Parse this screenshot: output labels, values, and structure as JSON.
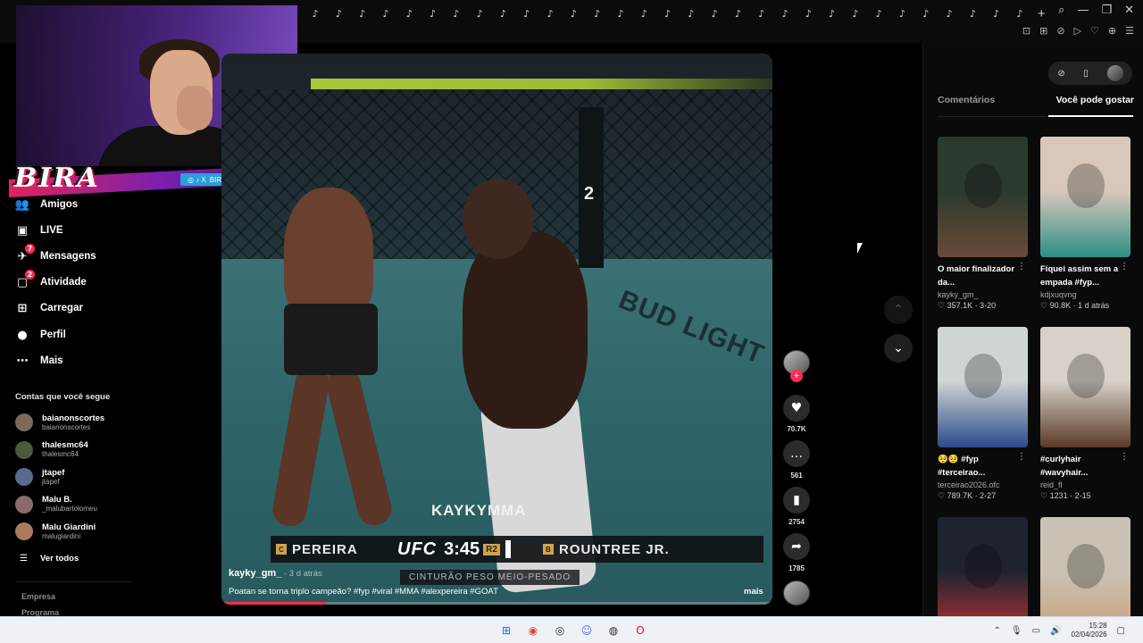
{
  "browser": {
    "tab_glyph": "♪",
    "tab_count": 31,
    "new_tab": "+",
    "window_controls": [
      "⌕",
      "—",
      "❐",
      "✕"
    ],
    "toolbar_icons": [
      "⊡",
      "⊞",
      "⊘",
      "▷",
      "♡",
      "⊕",
      "☰"
    ]
  },
  "stream_overlay": {
    "logo_text": "BIRA",
    "social_handle": "BIROPJL",
    "social_icons": "◎ ♪ X"
  },
  "sidebar": {
    "items": [
      {
        "label": "Amigos",
        "icon": "friends-icon",
        "glyph": "👥",
        "badge": ""
      },
      {
        "label": "LIVE",
        "icon": "live-icon",
        "glyph": "▣",
        "badge": ""
      },
      {
        "label": "Mensagens",
        "icon": "messages-icon",
        "glyph": "✈",
        "badge": "7"
      },
      {
        "label": "Atividade",
        "icon": "activity-icon",
        "glyph": "▢",
        "badge": "2"
      },
      {
        "label": "Carregar",
        "icon": "upload-icon",
        "glyph": "⊞",
        "badge": ""
      },
      {
        "label": "Perfil",
        "icon": "profile-icon",
        "glyph": "●",
        "badge": ""
      },
      {
        "label": "Mais",
        "icon": "more-icon",
        "glyph": "⋯",
        "badge": ""
      }
    ],
    "following_title": "Contas que você segue",
    "following": [
      {
        "name": "baianonscortes",
        "handle": "baianonscortes"
      },
      {
        "name": "thalesmc64",
        "handle": "thalesmc64"
      },
      {
        "name": "jtapef",
        "handle": "jtapef"
      },
      {
        "name": "Malu B.",
        "handle": "_malubartolomeu"
      },
      {
        "name": "Malu Giardini",
        "handle": "malugiardini"
      }
    ],
    "see_all": "Ver todos",
    "footer": [
      "Empresa",
      "Programa"
    ]
  },
  "video": {
    "watermark": "KAYKYMMA",
    "floor_ad": "BUD LIGHT",
    "post_number": "2",
    "scoreboard": {
      "red_corner": "C",
      "red_name": "PEREIRA",
      "brand": "UFC",
      "clock": "3:45",
      "round": "R2",
      "blue_corner": "B",
      "blue_name": "ROUNTREE JR."
    },
    "subtitle": "CINTURÃO PESO MEIO-PESADO",
    "author": "kayky_gm_",
    "time_ago": " · 3 d atrás",
    "description": "Poatan se torna triplo campeão? #fyp #viral #MMA #alexpereira #GOAT",
    "more": "mais",
    "progress": 0.19
  },
  "actions": {
    "follow_plus": "+",
    "likes": "70.7K",
    "comments": "561",
    "saves": "2754",
    "shares": "1785",
    "like_glyph": "♥",
    "comment_glyph": "…",
    "save_glyph": "▮",
    "share_glyph": "➦"
  },
  "feed_nav": {
    "up": "⌃",
    "down": "⌄"
  },
  "right_panel": {
    "pill_icons": [
      "⊘",
      "▯"
    ],
    "tabs": [
      {
        "label": "Comentários",
        "active": false
      },
      {
        "label": "Você pode gostar",
        "active": true
      }
    ],
    "recommendations": [
      {
        "title": "O maior finalizador da...",
        "author": "kayky_gm_",
        "stats": "♡ 357.1K · 3-20",
        "bg": "#2a3a2e",
        "accent": "#6b4a38"
      },
      {
        "title": "Fiquei assim sem a empada #fyp...",
        "author": "kdjxuqvng",
        "stats": "♡ 90.8K · 1 d atrás",
        "bg": "#d9c7bb",
        "accent": "#2e8f86"
      },
      {
        "title": "🥺🥺 #fyp #terceirao...",
        "author": "terceirao2026.ofc",
        "stats": "♡ 789.7K · 2-27",
        "bg": "#cfd6d2",
        "accent": "#2a4a8a"
      },
      {
        "title": "#curlyhair #wavyhair...",
        "author": "reid_fl",
        "stats": "♡ 1231 · 2-15",
        "bg": "#d8d1c8",
        "accent": "#5a3a26"
      },
      {
        "title": "",
        "author": "",
        "stats": "",
        "bg": "#1f2330",
        "accent": "#b33"
      },
      {
        "title": "",
        "author": "",
        "stats": "",
        "bg": "#c9c2b4",
        "accent": "#caa07a"
      }
    ],
    "menu_glyph": "⋮"
  },
  "taskbar": {
    "apps": [
      {
        "name": "windows-start-icon",
        "glyph": "⊞",
        "color": "#1a73e8"
      },
      {
        "name": "chrome-icon",
        "glyph": "◉",
        "color": "#e0443a"
      },
      {
        "name": "steam-icon",
        "glyph": "◎",
        "color": "#1b2838"
      },
      {
        "name": "discord-icon",
        "glyph": "☺",
        "color": "#5865f2"
      },
      {
        "name": "obs-icon",
        "glyph": "◍",
        "color": "#302e31"
      },
      {
        "name": "opera-icon",
        "glyph": "O",
        "color": "#e8102f"
      }
    ],
    "tray_glyphs": [
      "⌃",
      "🎙",
      "▭",
      "🔊"
    ],
    "time": "15:28",
    "date": "02/04/2026",
    "notifications_glyph": "▢"
  },
  "colors": {
    "accent": "#fe2c55",
    "panel": "#0a0a0a",
    "taskbar": "#eef1f6"
  }
}
